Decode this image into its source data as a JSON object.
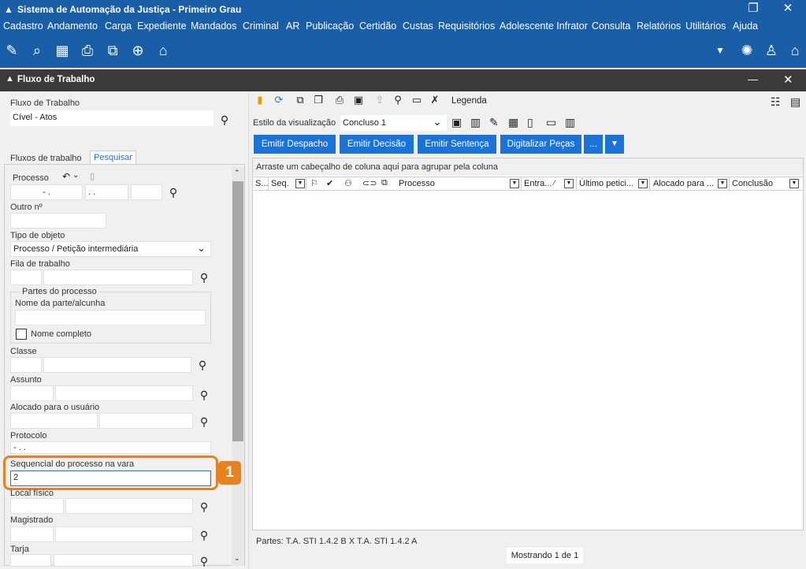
{
  "app": {
    "title": "Sistema de Automação da Justiça - Primeiro Grau",
    "window_restore": "❐",
    "window_close": "✕"
  },
  "menu": [
    "Cadastro",
    "Andamento",
    "Carga",
    "Expediente",
    "Mandados",
    "Criminal",
    "AR",
    "Publicação",
    "Certidão",
    "Custas",
    "Requisitórios",
    "Adolescente Infrator",
    "Consulta",
    "Relatórios",
    "Utilitários",
    "Ajuda"
  ],
  "subwindow": {
    "title": "Fluxo de Trabalho",
    "minimize": "—",
    "close": "✕"
  },
  "left": {
    "fluxo_label": "Fluxo de Trabalho",
    "fluxo_value": "Cível - Atos",
    "tabs": [
      "Fluxos de trabalho",
      "Pesquisar"
    ],
    "processo_label": "Processo",
    "processo_part1": "- .",
    "processo_part2": ". .",
    "outro_label": "Outro nº",
    "tipo_label": "Tipo de objeto",
    "tipo_value": "Processo / Petição intermediária",
    "fila_label": "Fila de trabalho",
    "partes_group": "Partes do processo",
    "nome_parte_label": "Nome da parte/alcunha",
    "nome_completo": "Nome completo",
    "classe_label": "Classe",
    "assunto_label": "Assunto",
    "alocado_label": "Alocado para o usuário",
    "protocolo_label": "Protocolo",
    "protocolo_value": "- . .",
    "sequencial_label": "Sequencial do processo na vara",
    "sequencial_value": "2",
    "local_label": "Local físico",
    "magistrado_label": "Magistrado",
    "tarja_label": "Tarja",
    "callout": "1"
  },
  "right": {
    "legenda": "Legenda",
    "estilo_label": "Estilo da visualização",
    "estilo_value": "Concluso 1",
    "buttons": [
      "Emitir Despacho",
      "Emitir Decisão",
      "Emitir Sentença",
      "Digitalizar Peças",
      "..."
    ],
    "group_hint": "Arraste um cabeçalho de coluna aqui para agrupar pela coluna",
    "columns": [
      "S...",
      "Seq.",
      "Processo",
      "Entra...",
      "Último petici...",
      "Alocado para ...",
      "Conclusão"
    ],
    "partes_footer": "Partes: T.A. STI 1.4.2 B  X  T.A. STI 1.4.2 A",
    "mostrando": "Mostrando 1 de 1"
  },
  "colors": {
    "brand": "#1a5ea8",
    "button": "#1a73d9",
    "callout": "#e8821e"
  }
}
